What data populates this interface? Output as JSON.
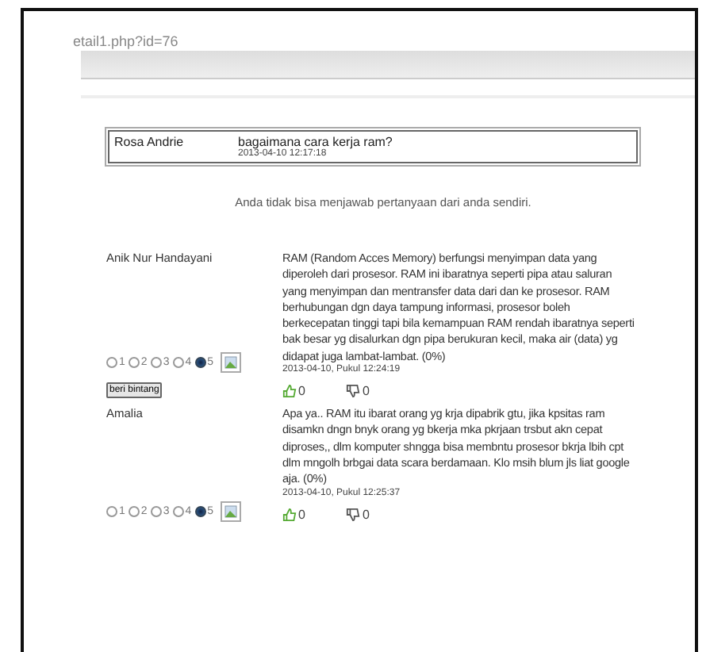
{
  "address": "etail1.php?id=76",
  "question": {
    "author": "Rosa Andrie",
    "text": "bagaimana cara kerja ram?",
    "date": "2013-04-10 12:17:18"
  },
  "notice": "Anda tidak bisa menjawab pertanyaan dari anda sendiri.",
  "answers": [
    {
      "name": "Anik Nur Handayani",
      "text": "RAM (Random Acces Memory) berfungsi menyimpan data yang diperoleh dari prosesor. RAM ini ibaratnya seperti pipa atau saluran yang menyimpan dan mentransfer data dari dan ke prosesor. RAM berhubungan dgn daya tampung informasi, prosesor boleh berkecepatan tinggi tapi bila kemampuan RAM rendah ibaratnya seperti bak besar yg disalurkan dgn pipa berukuran kecil, maka air (data) yg didapat juga lambat-lambat. (0%)",
      "date": "2013-04-10, Pukul 12:24:19",
      "ratings": [
        {
          "label": "1",
          "selected": false
        },
        {
          "label": "2",
          "selected": false
        },
        {
          "label": "3",
          "selected": false
        },
        {
          "label": "4",
          "selected": false
        },
        {
          "label": "5",
          "selected": true
        }
      ],
      "likes": "0",
      "dislikes": "0",
      "button": "beri bintang"
    },
    {
      "name": "Amalia",
      "text": "Apa ya.. RAM itu ibarat orang yg krja dipabrik gtu, jika kpsitas ram disamkn dngn bnyk orang yg bkerja mka pkrjaan trsbut akn cepat diproses,, dlm komputer shngga bisa membntu prosesor bkrja lbih cpt dlm mngolh brbgai data scara berdamaan. Klo msih blum jls liat google aja. (0%)",
      "date": "2013-04-10, Pukul 12:25:37",
      "ratings": [
        {
          "label": "1",
          "selected": false
        },
        {
          "label": "2",
          "selected": false
        },
        {
          "label": "3",
          "selected": false
        },
        {
          "label": "4",
          "selected": false
        },
        {
          "label": "5",
          "selected": true
        }
      ],
      "likes": "0",
      "dislikes": "0"
    }
  ]
}
